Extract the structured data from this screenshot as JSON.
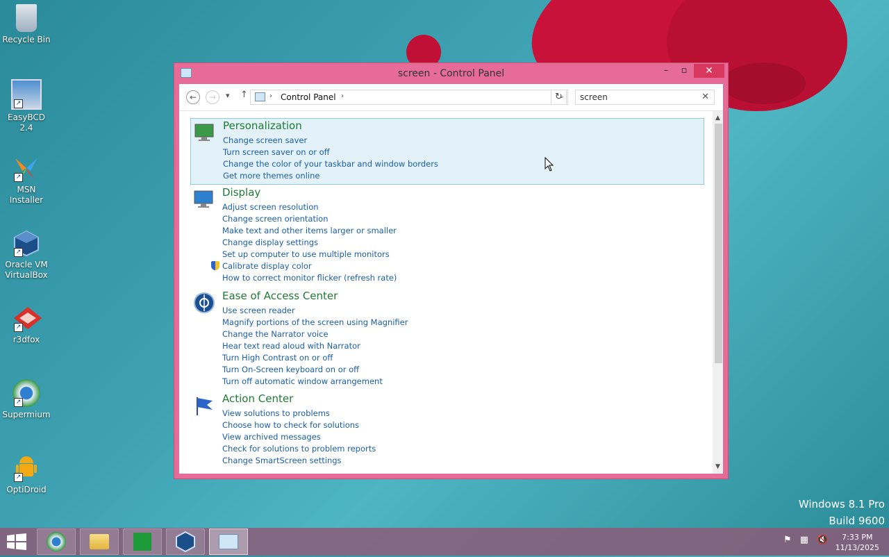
{
  "desktop": {
    "icons": [
      {
        "label": "Recycle Bin",
        "icon": "recycle-bin-icon"
      },
      {
        "label": "EasyBCD 2.4",
        "icon": "easybcd-icon"
      },
      {
        "label": "MSN Installer",
        "icon": "msn-butterfly-icon"
      },
      {
        "label": "Oracle VM VirtualBox",
        "icon": "virtualbox-icon"
      },
      {
        "label": "r3dfox",
        "icon": "r3dfox-icon"
      },
      {
        "label": "Supermium",
        "icon": "supermium-icon"
      },
      {
        "label": "OptiDroid",
        "icon": "android-icon"
      }
    ],
    "watermark": {
      "line1": "Windows 8.1 Pro",
      "line2": "Build 9600"
    }
  },
  "window": {
    "title": "screen - Control Panel",
    "controls": {
      "minimize": "–",
      "maximize": "▫",
      "close": "✕"
    },
    "nav": {
      "back": "←",
      "forward": "→",
      "recent": "▾",
      "up": "↑",
      "breadcrumb": "Control Panel",
      "refresh": "↻"
    },
    "search": {
      "value": "screen",
      "clear": "✕"
    },
    "groups": [
      {
        "title": "Personalization",
        "icon": "personalization-icon",
        "selected": true,
        "links": [
          "Change screen saver",
          "Turn screen saver on or off",
          "Change the color of your taskbar and window borders",
          "Get more themes online"
        ]
      },
      {
        "title": "Display",
        "icon": "display-icon",
        "links": [
          "Adjust screen resolution",
          "Change screen orientation",
          "Make text and other items larger or smaller",
          "Change display settings",
          "Set up computer to use multiple monitors",
          "Calibrate display color",
          "How to correct monitor flicker (refresh rate)"
        ]
      },
      {
        "title": "Ease of Access Center",
        "icon": "ease-of-access-icon",
        "links": [
          "Use screen reader",
          "Magnify portions of the screen using Magnifier",
          "Change the Narrator voice",
          "Hear text read aloud with Narrator",
          "Turn High Contrast on or off",
          "Turn On-Screen keyboard on or off",
          "Turn off automatic window arrangement"
        ]
      },
      {
        "title": "Action Center",
        "icon": "action-center-flag-icon",
        "links": [
          "View solutions to problems",
          "Choose how to check for solutions",
          "View archived messages",
          "Check for solutions to problem reports",
          "Change SmartScreen settings"
        ]
      }
    ]
  },
  "taskbar": {
    "items": [
      "internet-explorer-icon",
      "file-explorer-icon",
      "store-icon",
      "virtualbox-icon",
      "control-panel-icon"
    ],
    "clock": {
      "time": "7:33 PM",
      "date": "11/13/2025"
    }
  }
}
